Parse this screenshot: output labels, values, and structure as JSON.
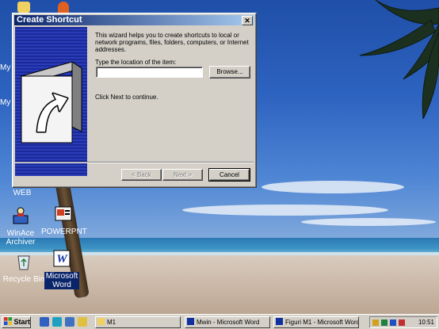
{
  "window": {
    "title": "Create Shortcut",
    "intro": "This wizard helps you to create shortcuts to local or network programs, files, folders, computers, or Internet addresses.",
    "location_label": "Type the location of the item:",
    "location_value": "",
    "browse_label": "Browse...",
    "next_hint": "Click Next to continue.",
    "back_label": "< Back",
    "next_label": "Next >",
    "cancel_label": "Cancel"
  },
  "desktop_icons": {
    "winace": "WinAce Archiver",
    "powerpnt": "POWERPNT",
    "recycle": "Recycle Bin",
    "word": "Microsoft Word",
    "partial_web": "WEB",
    "partial_my1": "My",
    "partial_my2": "My"
  },
  "taskbar": {
    "start": "Start",
    "tasks": [
      "M1",
      "Mwin - Microsoft Word",
      "Figuri M1 - Microsoft Word"
    ],
    "clock": "10:51"
  },
  "colors": {
    "titlebar_start": "#0a246a",
    "titlebar_end": "#a6caf0",
    "face": "#d4d0c8",
    "wizard_panel": "#1a2a9a"
  }
}
